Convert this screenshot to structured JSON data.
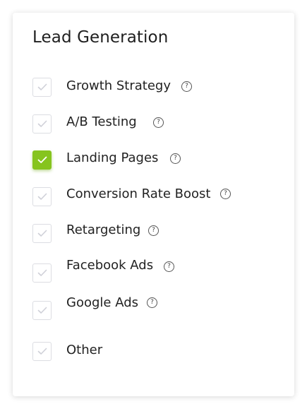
{
  "section": {
    "title": "Lead Generation"
  },
  "options": [
    {
      "label": "Growth Strategy",
      "checked": false,
      "help": "?"
    },
    {
      "label": "A/B Testing",
      "checked": false,
      "help": "?"
    },
    {
      "label": "Landing Pages",
      "checked": true,
      "help": "?"
    },
    {
      "label": "Conversion Rate Boost",
      "checked": false,
      "help": "?"
    },
    {
      "label": "Retargeting",
      "checked": false,
      "help": "?"
    },
    {
      "label": "Facebook Ads",
      "checked": false,
      "help": "?"
    },
    {
      "label": "Google Ads",
      "checked": false,
      "help": "?"
    },
    {
      "label": "Other",
      "checked": false
    }
  ],
  "colors": {
    "accent": "#86c41e",
    "unchecked_mark": "#cfd0d8"
  }
}
